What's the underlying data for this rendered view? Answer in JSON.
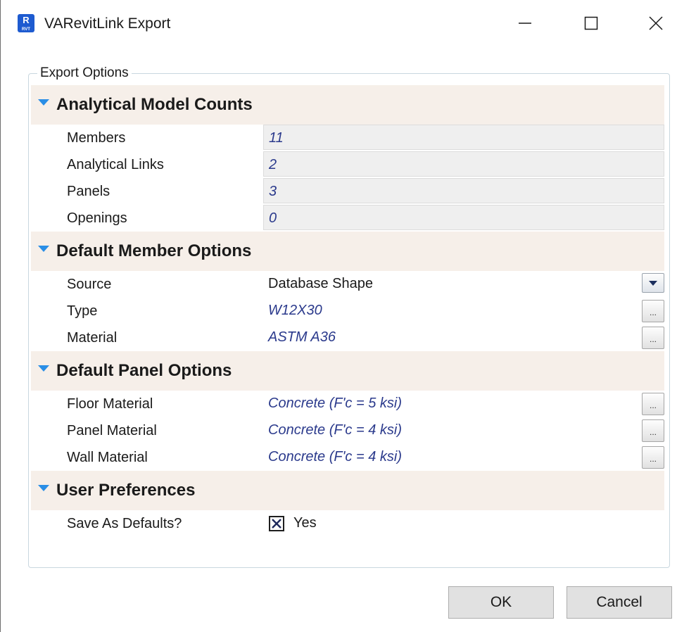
{
  "window": {
    "title": "VARevitLink Export",
    "icon": {
      "name": "revit-icon",
      "letter": "R",
      "sub": "RVT",
      "color": "#1e5bd0"
    }
  },
  "group": {
    "legend": "Export Options"
  },
  "categories": [
    {
      "label": "Analytical Model Counts",
      "rows": [
        {
          "name": "Members",
          "value": "11"
        },
        {
          "name": "Analytical Links",
          "value": "2"
        },
        {
          "name": "Panels",
          "value": "3"
        },
        {
          "name": "Openings",
          "value": "0"
        }
      ]
    },
    {
      "label": "Default Member Options",
      "rows": [
        {
          "name": "Source",
          "value": "Database Shape",
          "editor": "dropdown"
        },
        {
          "name": "Type",
          "value": "W12X30",
          "editor": "ellipsis",
          "button": "..."
        },
        {
          "name": "Material",
          "value": "ASTM A36",
          "editor": "ellipsis",
          "button": "..."
        }
      ]
    },
    {
      "label": "Default Panel Options",
      "rows": [
        {
          "name": "Floor Material",
          "value": "Concrete (F'c = 5 ksi)",
          "editor": "ellipsis",
          "button": "..."
        },
        {
          "name": "Panel Material",
          "value": "Concrete (F'c = 4 ksi)",
          "editor": "ellipsis",
          "button": "..."
        },
        {
          "name": "Wall Material",
          "value": "Concrete (F'c = 4 ksi)",
          "editor": "ellipsis",
          "button": "..."
        }
      ]
    },
    {
      "label": "User Preferences",
      "rows": [
        {
          "name": "Save As Defaults?",
          "value": "Yes",
          "editor": "checkbox",
          "checked": true
        }
      ]
    }
  ],
  "buttons": {
    "ok": "OK",
    "cancel": "Cancel"
  },
  "colors": {
    "category_bg": "#f6efe9",
    "accent": "#2a8ee6",
    "value_text": "#2b3a8c"
  }
}
